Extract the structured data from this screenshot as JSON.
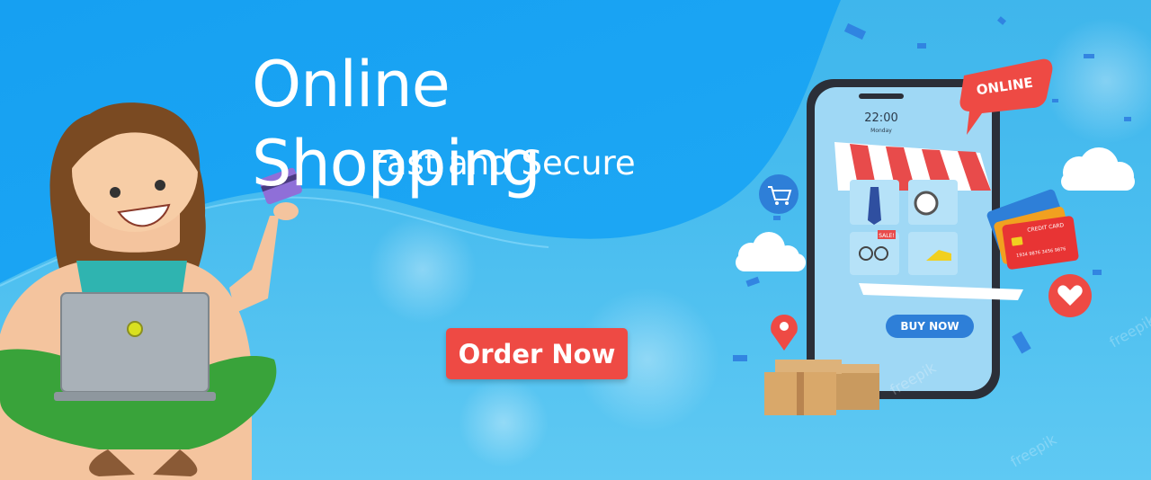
{
  "banner": {
    "title": "Online Shopping",
    "subtitle": "Fast and Secure",
    "cta_label": "Order Now"
  },
  "phone": {
    "time": "22:00",
    "day": "Monday",
    "sale_tag": "SALE!",
    "buy_label": "BUY NOW"
  },
  "speech_bubble": {
    "label": "ONLINE"
  },
  "cards": {
    "label": "CREDIT CARD",
    "number": "1934 9876 3456 9876"
  },
  "watermark": "freepik",
  "colors": {
    "accent": "#ee4a44",
    "background_blue": "#2a9ff0",
    "light_blue": "#5fc9f3",
    "button_blue": "#2e7fd8",
    "pants_green": "#39a33a"
  },
  "icons": [
    "cart-icon",
    "heart-icon",
    "location-pin-icon",
    "cloud-icon",
    "credit-card-icon",
    "laptop-icon"
  ]
}
